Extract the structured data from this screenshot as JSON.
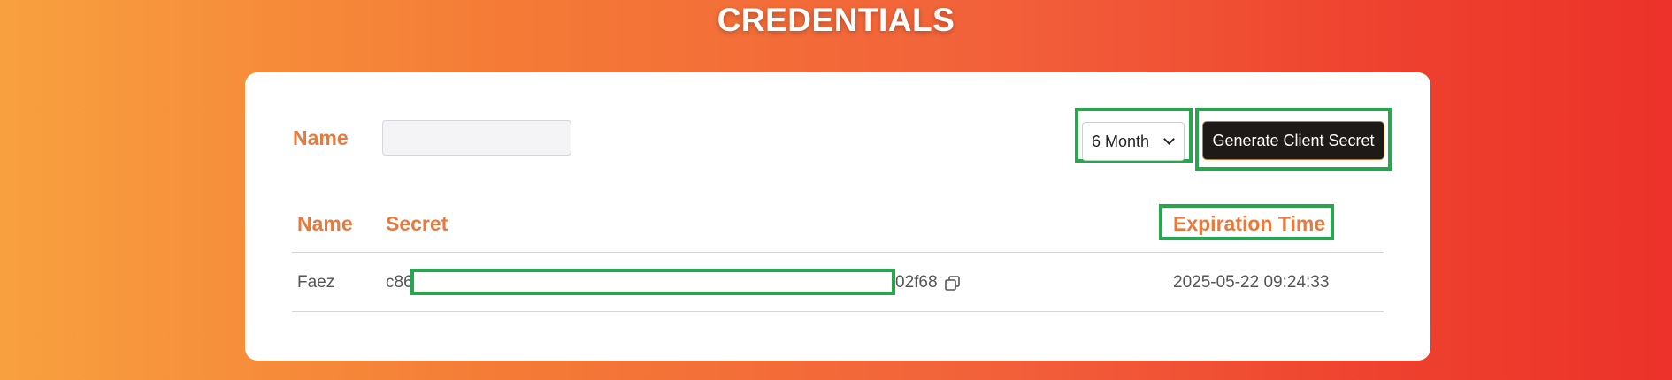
{
  "page": {
    "title": "CREDENTIALS"
  },
  "form": {
    "name_label": "Name",
    "name_value": "",
    "name_placeholder": "",
    "duration_selected": "6 Month",
    "generate_label": "Generate Client Secret"
  },
  "table": {
    "headers": {
      "name": "Name",
      "secret": "Secret",
      "expiration": "Expiration Time"
    },
    "rows": [
      {
        "name": "Faez",
        "secret_start": "c86",
        "secret_end": "02f68",
        "expiration": "2025-05-22 09:24:33"
      }
    ]
  },
  "colors": {
    "accent": "#e8793c",
    "highlight": "#27a74d",
    "button_bg": "#1e1a17"
  }
}
